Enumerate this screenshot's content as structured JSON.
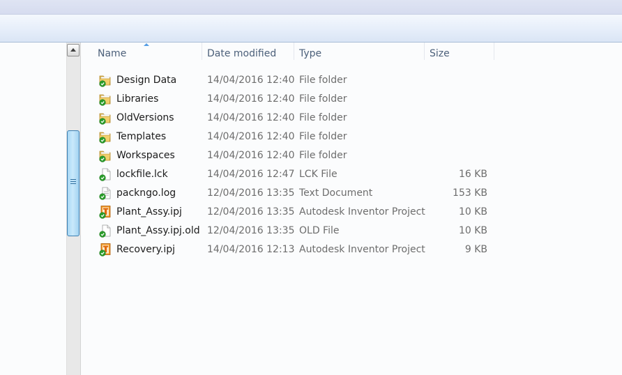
{
  "columns": {
    "name": "Name",
    "date": "Date modified",
    "type": "Type",
    "size": "Size"
  },
  "files": [
    {
      "name": "Design Data",
      "date": "14/04/2016 12:40",
      "type": "File folder",
      "size": "",
      "icon": "folder-icon"
    },
    {
      "name": "Libraries",
      "date": "14/04/2016 12:40",
      "type": "File folder",
      "size": "",
      "icon": "folder-icon"
    },
    {
      "name": "OldVersions",
      "date": "14/04/2016 12:40",
      "type": "File folder",
      "size": "",
      "icon": "folder-icon"
    },
    {
      "name": "Templates",
      "date": "14/04/2016 12:40",
      "type": "File folder",
      "size": "",
      "icon": "folder-icon"
    },
    {
      "name": "Workspaces",
      "date": "14/04/2016 12:40",
      "type": "File folder",
      "size": "",
      "icon": "folder-icon"
    },
    {
      "name": "lockfile.lck",
      "date": "14/04/2016 12:47",
      "type": "LCK File",
      "size": "16 KB",
      "icon": "blank-file-icon"
    },
    {
      "name": "packngo.log",
      "date": "12/04/2016 13:35",
      "type": "Text Document",
      "size": "153 KB",
      "icon": "text-file-icon"
    },
    {
      "name": "Plant_Assy.ipj",
      "date": "12/04/2016 13:35",
      "type": "Autodesk Inventor Project",
      "size": "10 KB",
      "icon": "inventor-project-icon"
    },
    {
      "name": "Plant_Assy.ipj.old",
      "date": "12/04/2016 13:35",
      "type": "OLD File",
      "size": "10 KB",
      "icon": "blank-file-icon"
    },
    {
      "name": "Recovery.ipj",
      "date": "14/04/2016 12:13",
      "type": "Autodesk Inventor Project",
      "size": "9 KB",
      "icon": "inventor-project-icon"
    }
  ],
  "colors": {
    "header_text": "#4c607a",
    "secondary_text": "#6d6d6d",
    "sort_arrow": "#569de5",
    "sync_check": "#2a9c2a"
  }
}
